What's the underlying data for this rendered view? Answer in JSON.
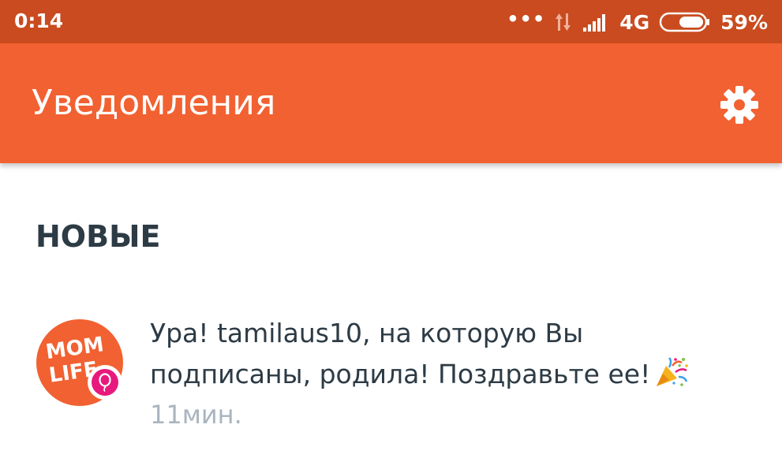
{
  "status_bar": {
    "time": "0:14",
    "dots": "•••",
    "network": "4G",
    "battery": "59%",
    "icons": [
      "data-arrows-icon",
      "signal-icon",
      "battery-icon"
    ]
  },
  "app_bar": {
    "title": "Уведомления",
    "settings_icon": "gear-icon",
    "background_color": "#f26131"
  },
  "section": {
    "title": "НОВЫЕ"
  },
  "notifications": [
    {
      "avatar_text": "MOM LIFE",
      "text": "Ура! tamilaus10, на которую Вы подписаны, родила! Поздравьте ее!",
      "emoji_icon": "party-popper-icon",
      "time": "11мин."
    }
  ],
  "colors": {
    "status_bar": "#c94b1f",
    "accent": "#f26131",
    "badge": "#e8197d",
    "text": "#2d3b45",
    "muted": "#a9b5bf"
  }
}
